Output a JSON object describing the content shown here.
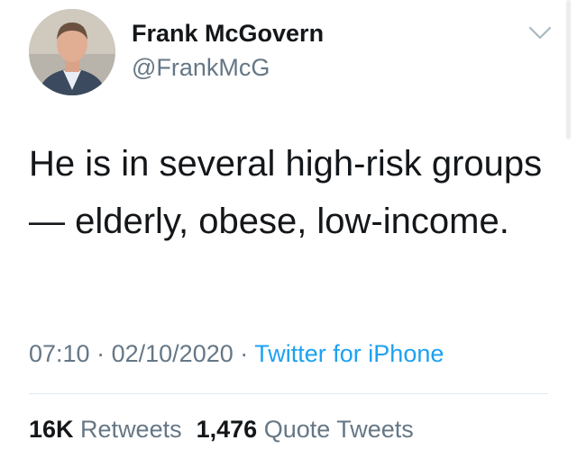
{
  "author": {
    "name": "Frank McGovern",
    "handle": "@FrankMcG"
  },
  "tweet": {
    "text": "He is in several high-risk groups — elderly, obese, low-income."
  },
  "meta": {
    "time": "07:10",
    "separator": "·",
    "date": "02/10/2020",
    "source": "Twitter for iPhone"
  },
  "stats": {
    "retweets_count": "16K",
    "retweets_label": "Retweets",
    "quotes_count": "1,476",
    "quotes_label": "Quote Tweets"
  },
  "icons": {
    "menu": "chevron-down-icon",
    "avatar": "avatar"
  },
  "colors": {
    "text": "#14171a",
    "secondary": "#657786",
    "link": "#1da1f2",
    "divider": "#e1e8ed"
  }
}
